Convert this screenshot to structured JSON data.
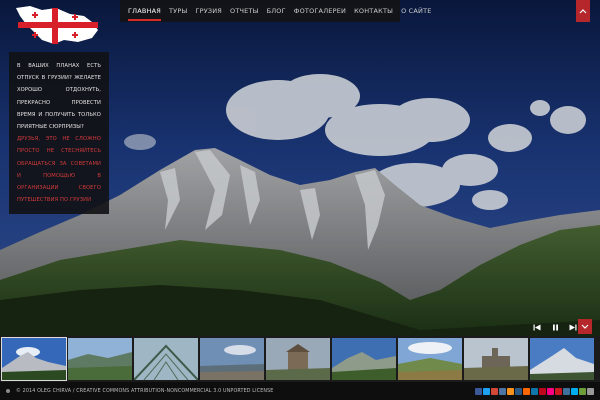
{
  "nav": {
    "items": [
      {
        "label": "ГЛАВНАЯ",
        "active": true
      },
      {
        "label": "ТУРЫ",
        "active": false
      },
      {
        "label": "ГРУЗИЯ",
        "active": false
      },
      {
        "label": "ОТЧЕТЫ",
        "active": false
      },
      {
        "label": "БЛОГ",
        "active": false
      },
      {
        "label": "ФОТОГАЛЕРЕИ",
        "active": false
      },
      {
        "label": "КОНТАКТЫ",
        "active": false
      },
      {
        "label": "О САЙТЕ",
        "active": false
      }
    ]
  },
  "info": {
    "p1": "В ВАШИХ ПЛАНАХ ЕСТЬ ОТПУСК В ГРУЗИИ? ЖЕЛАЕТЕ ХОРОШО ОТДОХНУТЬ, ПРЕКРАСНО ПРОВЕСТИ ВРЕМЯ И ПОЛУЧИТЬ ТОЛЬКО ПРИЯТНЫЕ СЮРПРИЗЫ?",
    "p2": "ДРУЗЬЯ, ЭТО НЕ СЛОЖНО ПРОСТО НЕ СТЕСНЯЙТЕСЬ ОБРАЩАТЬСЯ ЗА СОВЕТАМИ И ПОМОЩЬЮ В ОРГАНИЗАЦИИ СВОЕГО ПУТЕШЕСТВИЯ ПО ГРУЗИИ"
  },
  "footer": {
    "copyright": "© 2014 OLEG CHIRVA / CREATIVE COMMONS ATTRIBUTION-NONCOMMERCIAL 3.0 UNPORTED LICENSE"
  },
  "colors": {
    "accent": "#b5272a",
    "panel_bg": "#121214",
    "nav_bg": "#141416",
    "highlight_text": "#d23a3a"
  },
  "icons": {
    "logo": "georgia-map-flag-logo",
    "prev": "skip-back-icon",
    "pause": "pause-icon",
    "next": "skip-forward-icon",
    "toggle": "chevron-down-icon",
    "top_tab": "chevron-up-icon"
  },
  "thumbnails": {
    "count": 9,
    "active_index": 0
  },
  "social": {
    "count": 15
  }
}
